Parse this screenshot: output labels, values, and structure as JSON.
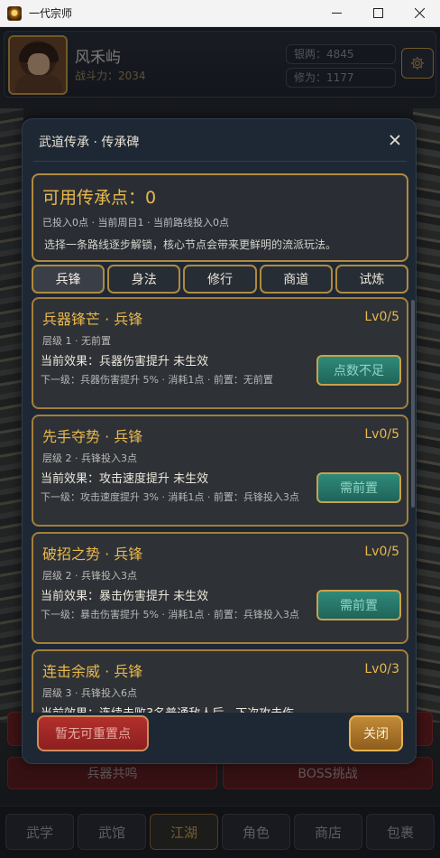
{
  "window": {
    "title": "一代宗师"
  },
  "header": {
    "player_name": "风禾屿",
    "power": "战斗力：2034",
    "silver": "银两：4845",
    "cultivation": "修为：1177"
  },
  "background": {
    "row2_left": "兵器共鸣",
    "row2_right": "BOSS挑战"
  },
  "bottom_nav": [
    {
      "label": "武学"
    },
    {
      "label": "武馆"
    },
    {
      "label": "江湖",
      "active": true
    },
    {
      "label": "角色"
    },
    {
      "label": "商店"
    },
    {
      "label": "包裹"
    }
  ],
  "modal": {
    "title": "武道传承 · 传承碑",
    "available_points": "可用传承点：0",
    "meta": "已投入0点 · 当前周目1 · 当前路线投入0点",
    "description": "选择一条路线逐步解锁，核心节点会带来更鲜明的流派玩法。",
    "tabs": [
      {
        "label": "兵锋",
        "active": true
      },
      {
        "label": "身法"
      },
      {
        "label": "修行"
      },
      {
        "label": "商道"
      },
      {
        "label": "试炼"
      }
    ],
    "cards": [
      {
        "name": "兵器锋芒 · 兵锋",
        "level": "Lv0/5",
        "tier": "层级 1 · 无前置",
        "effect": "当前效果：兵器伤害提升 未生效",
        "next": "下一级：兵器伤害提升 5% · 消耗1点 · 前置：无前置",
        "button": "点数不足"
      },
      {
        "name": "先手夺势 · 兵锋",
        "level": "Lv0/5",
        "tier": "层级 2 · 兵锋投入3点",
        "effect": "当前效果：攻击速度提升 未生效",
        "next": "下一级：攻击速度提升 3% · 消耗1点 · 前置：兵锋投入3点",
        "button": "需前置"
      },
      {
        "name": "破招之势 · 兵锋",
        "level": "Lv0/5",
        "tier": "层级 2 · 兵锋投入3点",
        "effect": "当前效果：暴击伤害提升 未生效",
        "next": "下一级：暴击伤害提升 5% · 消耗1点 · 前置：兵锋投入3点",
        "button": "需前置"
      },
      {
        "name": "连击余威 · 兵锋",
        "level": "Lv0/3",
        "tier": "层级 3 · 兵锋投入6点",
        "effect": "当前效果：连续击败3名普通敌人后，下次攻击伤",
        "next": "",
        "button": ""
      }
    ],
    "reset_button": "暂无可重置点",
    "close_button": "关闭"
  }
}
